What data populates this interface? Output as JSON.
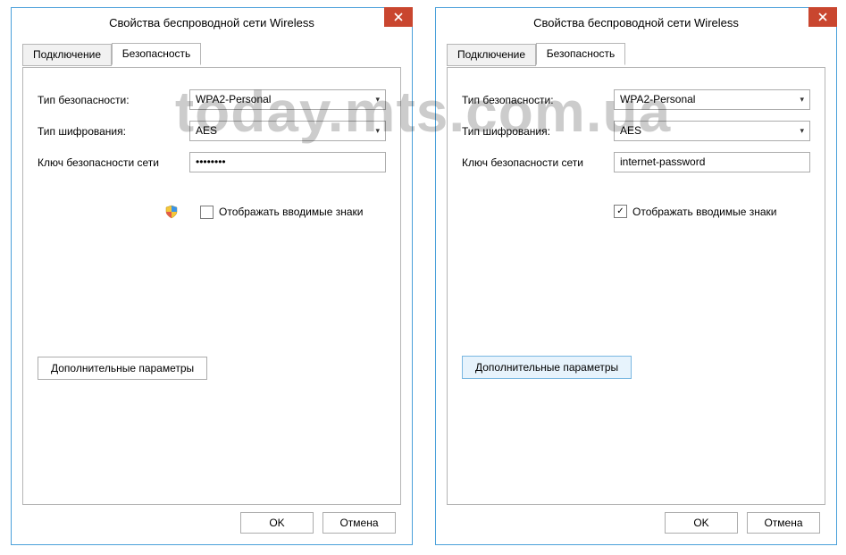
{
  "watermark": "today.mts.com.ua",
  "window": {
    "title": "Свойства беспроводной сети Wireless",
    "tabs": {
      "connection": "Подключение",
      "security": "Безопасность"
    },
    "labels": {
      "sec_type": "Тип безопасности:",
      "enc_type": "Тип шифрования:",
      "net_key": "Ключ безопасности сети",
      "show_chars": "Отображать вводимые знаки",
      "advanced": "Дополнительные параметры",
      "ok": "OK",
      "cancel": "Отмена"
    },
    "values": {
      "sec_type": "WPA2-Personal",
      "enc_type": "AES"
    }
  },
  "left": {
    "key_value": "••••••••",
    "show_checked": false,
    "has_shield": true,
    "adv_primary": false
  },
  "right": {
    "key_value": "internet-password",
    "show_checked": true,
    "has_shield": false,
    "adv_primary": true
  }
}
